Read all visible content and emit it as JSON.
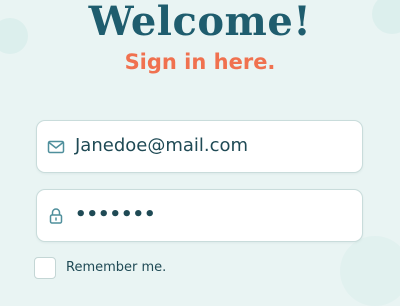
{
  "header": {
    "title": "Welcome!",
    "subtitle": "Sign in here."
  },
  "form": {
    "email": {
      "value": "Janedoe@mail.com",
      "icon": "mail-icon"
    },
    "password": {
      "value": "•••••••",
      "icon": "lock-icon"
    },
    "remember": {
      "label": "Remember me.",
      "checked": false
    }
  },
  "colors": {
    "background": "#e9f4f3",
    "title": "#1f5d6e",
    "subtitle": "#f0714f",
    "text": "#1f4a55",
    "field_border": "#c9dcdb"
  }
}
